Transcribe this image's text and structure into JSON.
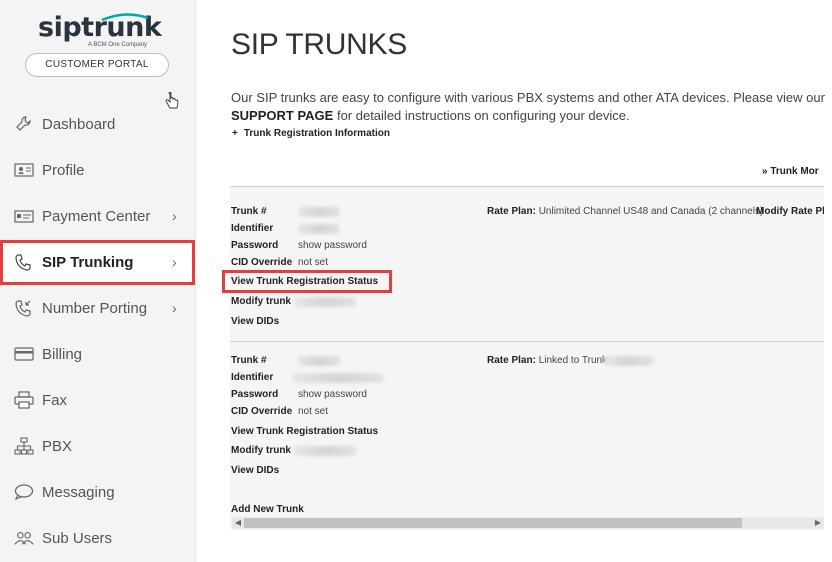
{
  "brand": {
    "logo_sip": "sip",
    "logo_trunk": "trunk",
    "tagline": "A BCM One Company",
    "accent": "#00a7b5",
    "highlight": "#e0403f"
  },
  "portal_button": "CUSTOMER PORTAL",
  "nav": [
    {
      "label": "Dashboard",
      "icon": "wrench-icon",
      "chevron": ""
    },
    {
      "label": "Profile",
      "icon": "id-card-icon",
      "chevron": ""
    },
    {
      "label": "Payment Center",
      "icon": "payment-icon",
      "chevron": "›"
    },
    {
      "label": "SIP Trunking",
      "icon": "phone-icon",
      "chevron": "›"
    },
    {
      "label": "Number Porting",
      "icon": "phone-porting-icon",
      "chevron": "›"
    },
    {
      "label": "Billing",
      "icon": "credit-card-icon",
      "chevron": ""
    },
    {
      "label": "Fax",
      "icon": "fax-icon",
      "chevron": ""
    },
    {
      "label": "PBX",
      "icon": "pbx-icon",
      "chevron": ""
    },
    {
      "label": "Messaging",
      "icon": "chat-icon",
      "chevron": ""
    },
    {
      "label": "Sub Users",
      "icon": "users-icon",
      "chevron": ""
    }
  ],
  "main": {
    "title": "SIP TRUNKS",
    "intro_1": "Our SIP trunks are easy to configure with various PBX systems and other ATA devices. Please view our",
    "support_link": "SUPPORT PAGE",
    "intro_2": " for detailed instructions on configuring your device.",
    "reg_info_toggle": "+",
    "reg_info": "Trunk Registration Information",
    "trunk_more": "» Trunk Mor"
  },
  "trunks": [
    {
      "trunk_label": "Trunk #",
      "identifier_label": "Identifier",
      "password_label": "Password",
      "password_value": "show password",
      "cid_label": "CID Override",
      "cid_value": "not set",
      "view_status": "View Trunk Registration Status",
      "modify_trunk": "Modify trunk",
      "view_dids": "View DIDs",
      "rate_plan_label": "Rate Plan:",
      "rate_plan_value": "Unlimited Channel US48 and Canada (2 channels)",
      "modify_rate": "Modify Rate Pl"
    },
    {
      "trunk_label": "Trunk #",
      "identifier_label": "Identifier",
      "password_label": "Password",
      "password_value": "show password",
      "cid_label": "CID Override",
      "cid_value": "not set",
      "view_status": "View Trunk Registration Status",
      "modify_trunk": "Modify trunk",
      "view_dids": "View DIDs",
      "rate_plan_label": "Rate Plan:",
      "rate_plan_value": "Linked to Trunk"
    }
  ],
  "add_trunk": "Add New Trunk",
  "scroll": {
    "left": "◀",
    "right": "▶"
  }
}
